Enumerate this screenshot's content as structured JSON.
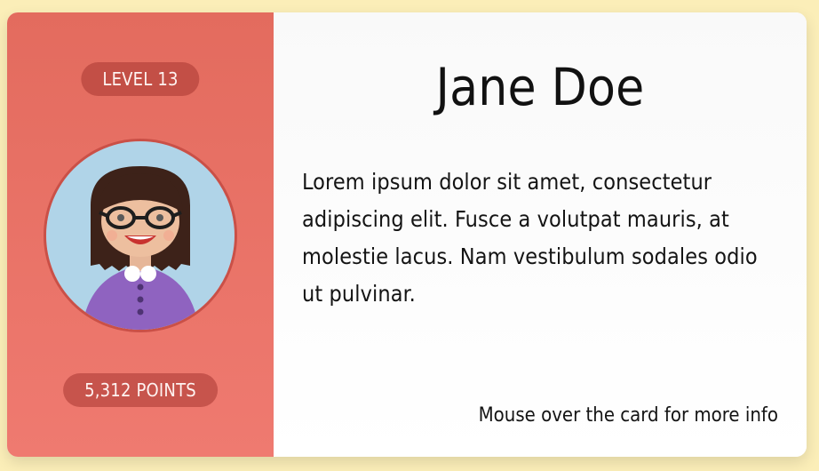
{
  "card": {
    "level_label": "LEVEL 13",
    "points_label": "5,312 POINTS",
    "name": "Jane Doe",
    "description": "Lorem ipsum dolor sit amet, consectetur adipiscing elit. Fusce a volutpat mauris, at molestie lacus. Nam vestibulum sodales odio ut pulvinar.",
    "hint": "Mouse over the card for more info",
    "avatar_icon": "woman-with-glasses-avatar-icon"
  },
  "colors": {
    "page_background": "#fbeeb8",
    "left_panel": "#e36b5e",
    "pill": "#c24e47",
    "avatar_background": "#b0d4e8",
    "card_background": "#ffffff"
  }
}
